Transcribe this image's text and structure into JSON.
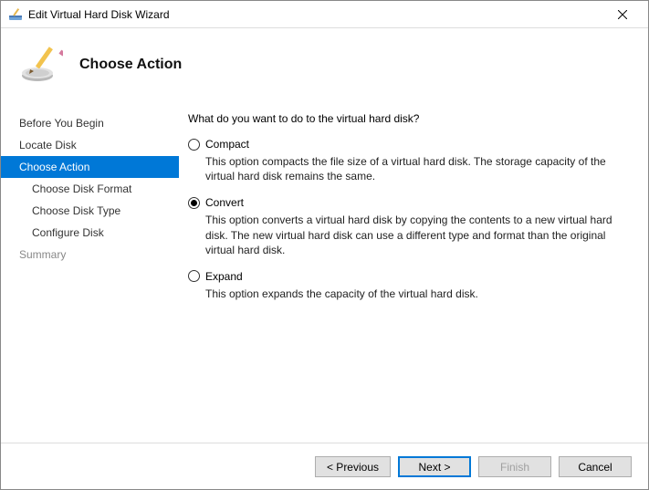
{
  "window": {
    "title": "Edit Virtual Hard Disk Wizard"
  },
  "page": {
    "heading": "Choose Action"
  },
  "sidebar": {
    "items": [
      {
        "label": "Before You Begin",
        "sub": false,
        "active": false,
        "disabled": false
      },
      {
        "label": "Locate Disk",
        "sub": false,
        "active": false,
        "disabled": false
      },
      {
        "label": "Choose Action",
        "sub": false,
        "active": true,
        "disabled": false
      },
      {
        "label": "Choose Disk Format",
        "sub": true,
        "active": false,
        "disabled": false
      },
      {
        "label": "Choose Disk Type",
        "sub": true,
        "active": false,
        "disabled": false
      },
      {
        "label": "Configure Disk",
        "sub": true,
        "active": false,
        "disabled": false
      },
      {
        "label": "Summary",
        "sub": false,
        "active": false,
        "disabled": true
      }
    ]
  },
  "main": {
    "question": "What do you want to do to the virtual hard disk?",
    "options": [
      {
        "label": "Compact",
        "description": "This option compacts the file size of a virtual hard disk. The storage capacity of the virtual hard disk remains the same.",
        "selected": false
      },
      {
        "label": "Convert",
        "description": "This option converts a virtual hard disk by copying the contents to a new virtual hard disk. The new virtual hard disk can use a different type and format than the original virtual hard disk.",
        "selected": true
      },
      {
        "label": "Expand",
        "description": "This option expands the capacity of the virtual hard disk.",
        "selected": false
      }
    ]
  },
  "footer": {
    "previous": "< Previous",
    "next": "Next >",
    "finish": "Finish",
    "cancel": "Cancel"
  }
}
